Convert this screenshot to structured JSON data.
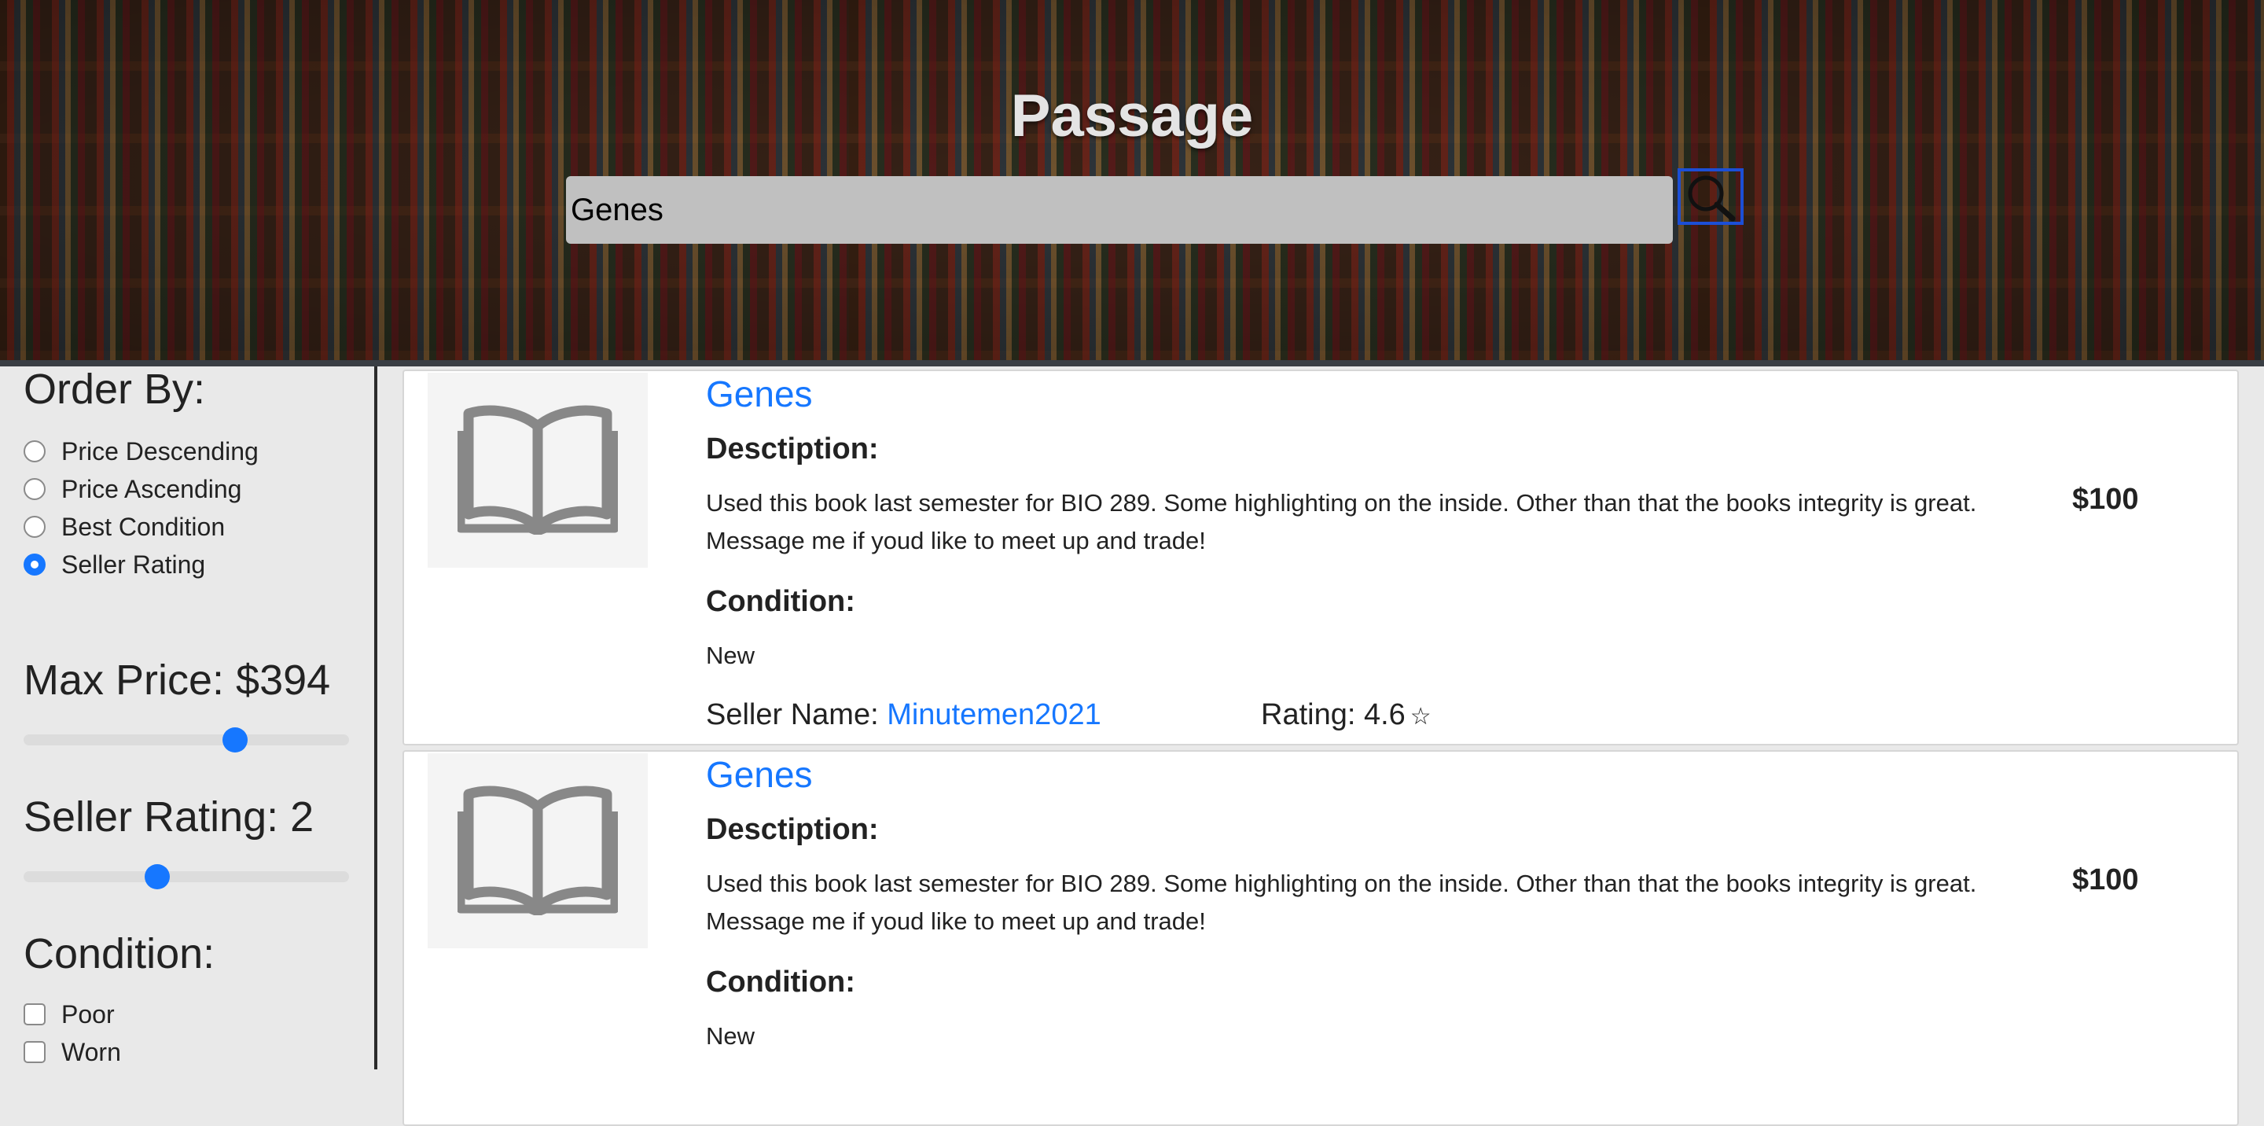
{
  "header": {
    "title": "Passage",
    "search_value": "Genes",
    "search_icon": "magnifier-icon"
  },
  "sidebar": {
    "order_by": {
      "heading": "Order By:",
      "options": [
        {
          "label": "Price Descending",
          "checked": false
        },
        {
          "label": "Price Ascending",
          "checked": false
        },
        {
          "label": "Best Condition",
          "checked": false
        },
        {
          "label": "Seller Rating",
          "checked": true
        }
      ]
    },
    "max_price": {
      "heading": "Max Price: $394",
      "slider_fraction": 0.65
    },
    "seller_rating": {
      "heading": "Seller Rating: 2",
      "slider_fraction": 0.41
    },
    "condition": {
      "heading": "Condition:",
      "options": [
        {
          "label": "Poor",
          "checked": false
        },
        {
          "label": "Worn",
          "checked": false
        }
      ]
    }
  },
  "listings": [
    {
      "title": "Genes",
      "description_label": "Desctiption:",
      "description": "Used this book last semester for BIO 289. Some highlighting on the inside. Other than that the books integrity is great. Message me if youd like to meet up and trade!",
      "condition_label": "Condition:",
      "condition": "New",
      "price": "$100",
      "seller_label": "Seller Name:",
      "seller_name": "Minutemen2021",
      "rating_label": "Rating: 4.6",
      "rating_icon": "star-outline-icon",
      "image_icon": "open-book-icon"
    },
    {
      "title": "Genes",
      "description_label": "Desctiption:",
      "description": "Used this book last semester for BIO 289. Some highlighting on the inside. Other than that the books integrity is great. Message me if youd like to meet up and trade!",
      "condition_label": "Condition:",
      "condition": "New",
      "price": "$100",
      "image_icon": "open-book-icon"
    }
  ],
  "colors": {
    "accent": "#1677ff",
    "search_field": "#c0c0c0",
    "sidebar_bg": "#e9e9e9"
  }
}
